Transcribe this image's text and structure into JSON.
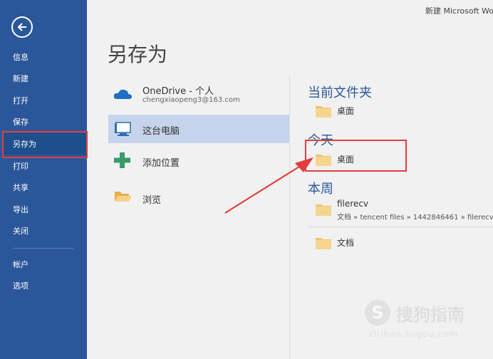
{
  "window": {
    "title": "新建 Microsoft Wo"
  },
  "sidebar": {
    "items": [
      {
        "label": "信息"
      },
      {
        "label": "新建"
      },
      {
        "label": "打开"
      },
      {
        "label": "保存"
      },
      {
        "label": "另存为"
      },
      {
        "label": "打印"
      },
      {
        "label": "共享"
      },
      {
        "label": "导出"
      },
      {
        "label": "关闭"
      },
      {
        "label": "帐户"
      },
      {
        "label": "选项"
      }
    ]
  },
  "main": {
    "title": "另存为",
    "locations": [
      {
        "label": "OneDrive - 个人",
        "sub": "chengxiaopeng3@163.com",
        "icon": "onedrive-cloud-icon"
      },
      {
        "label": "这台电脑",
        "icon": "computer-icon"
      },
      {
        "label": "添加位置",
        "icon": "plus-icon"
      },
      {
        "label": "浏览",
        "icon": "open-folder-icon"
      }
    ],
    "sections": {
      "current_folder": {
        "heading": "当前文件夹",
        "items": [
          {
            "label": "桌面"
          }
        ]
      },
      "today": {
        "heading": "今天",
        "items": [
          {
            "label": "桌面"
          }
        ]
      },
      "this_week": {
        "heading": "本周",
        "items": [
          {
            "label": "filerecv",
            "path": "文档 » tencent files » 1442846461 » filerecv"
          },
          {
            "label": "文档"
          }
        ]
      }
    }
  },
  "watermark": {
    "brand": "搜狗指南",
    "url": "zhinan.sogou.com"
  },
  "colors": {
    "sidebar": "#2b579a",
    "accent": "#2b579a",
    "selected": "#c5d4ea",
    "annotation": "#e23d3d",
    "folder": "#f0c36d"
  }
}
